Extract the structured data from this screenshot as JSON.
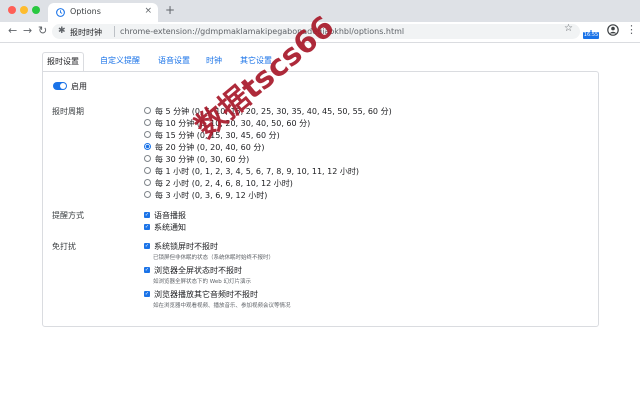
{
  "browser": {
    "tab_title": "Options",
    "tab_close": "×",
    "new_tab": "+",
    "omnibox_name": "报时时钟",
    "url": "chrome-extension://gdmpmaklamakipegabonadegiaokhbl/options.html",
    "extension_badge": "16:55"
  },
  "page_tabs": [
    "报时设置",
    "自定义提醒",
    "语音设置",
    "时钟",
    "其它设置"
  ],
  "enable_label": "启用",
  "sections": {
    "period_label": "报时周期",
    "remind_label": "提醒方式",
    "dnd_label": "免打扰"
  },
  "period_options": [
    "每 5 分钟 (0, 5, 10, 15, 20, 25, 30, 35, 40, 45, 50, 55, 60 分)",
    "每 10 分钟 (0, 10, 20, 30, 40, 50, 60 分)",
    "每 15 分钟 (0, 15, 30, 45, 60 分)",
    "每 20 分钟 (0, 20, 40, 60 分)",
    "每 30 分钟 (0, 30, 60 分)",
    "每 1 小时 (0, 1, 2, 3, 4, 5, 6, 7, 8, 9, 10, 11, 12 小时)",
    "每 2 小时 (0, 2, 4, 6, 8, 10, 12 小时)",
    "每 3 小时 (0, 3, 6, 9, 12 小时)"
  ],
  "period_selected_index": 3,
  "remind_options": [
    "语音播报",
    "系统通知"
  ],
  "dnd_options": [
    {
      "label": "系统锁屏时不报时",
      "hint": "已锁屏但非休眠的状态（系统休眠时始终不报时）"
    },
    {
      "label": "浏览器全屏状态时不报时",
      "hint": "如浏览器全屏状态下的 Web 幻灯片演示"
    },
    {
      "label": "浏览器播放其它音频时不报时",
      "hint": "如在浏览器中观看视频、播放音乐、参加视频会议等情况"
    }
  ],
  "watermark_text": "数据tscs66",
  "colors": {
    "accent": "#1a73e8",
    "watermark": "#a8192a"
  }
}
